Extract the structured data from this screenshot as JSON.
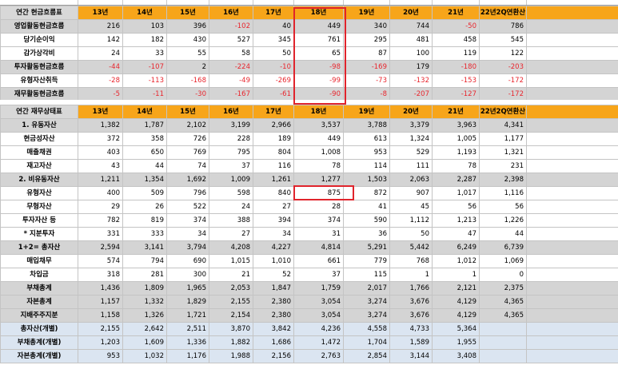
{
  "colors": {
    "header_orange": "#f7a51a",
    "negative_red": "#e8262e",
    "highlight_gray": "#d4d4d4",
    "standalone_blue": "#dbe5f1",
    "annotation_box_red": "#e0242c"
  },
  "cashflow": {
    "headers": [
      "연간 현금흐름표",
      "13년",
      "14년",
      "15년",
      "16년",
      "17년",
      "18년",
      "19년",
      "20년",
      "21년",
      "22년2Q연환산"
    ],
    "rows": [
      {
        "label": "영업활동현금흐름",
        "values": [
          "216",
          "103",
          "396",
          "-102",
          "40",
          "449",
          "340",
          "744",
          "-50",
          "786"
        ]
      },
      {
        "label": "당기순이익",
        "values": [
          "142",
          "182",
          "430",
          "527",
          "345",
          "761",
          "295",
          "481",
          "458",
          "545"
        ]
      },
      {
        "label": "감가상각비",
        "values": [
          "24",
          "33",
          "55",
          "58",
          "50",
          "65",
          "87",
          "100",
          "119",
          "122"
        ]
      },
      {
        "label": "투자활동현금흐름",
        "values": [
          "-44",
          "-107",
          "2",
          "-224",
          "-10",
          "-98",
          "-169",
          "179",
          "-180",
          "-203"
        ]
      },
      {
        "label": "유형자산취득",
        "values": [
          "-28",
          "-113",
          "-168",
          "-49",
          "-269",
          "-99",
          "-73",
          "-132",
          "-153",
          "-172"
        ]
      },
      {
        "label": "재무활동현금흐름",
        "values": [
          "-5",
          "-11",
          "-30",
          "-167",
          "-61",
          "-90",
          "-8",
          "-207",
          "-127",
          "-172"
        ]
      }
    ]
  },
  "balance": {
    "headers": [
      "연간 재무상태표",
      "13년",
      "14년",
      "15년",
      "16년",
      "17년",
      "18년",
      "19년",
      "20년",
      "21년",
      "22년2Q연환산"
    ],
    "rows": [
      {
        "label": "1. 유동자산",
        "values": [
          "1,382",
          "1,787",
          "2,102",
          "3,199",
          "2,966",
          "3,537",
          "3,788",
          "3,379",
          "3,963",
          "4,341"
        ]
      },
      {
        "label": "현금성자산",
        "values": [
          "372",
          "358",
          "726",
          "228",
          "189",
          "449",
          "613",
          "1,324",
          "1,005",
          "1,177"
        ]
      },
      {
        "label": "매출채권",
        "values": [
          "403",
          "650",
          "769",
          "795",
          "804",
          "1,008",
          "953",
          "529",
          "1,193",
          "1,321"
        ]
      },
      {
        "label": "재고자산",
        "values": [
          "43",
          "44",
          "74",
          "37",
          "116",
          "78",
          "114",
          "111",
          "78",
          "231"
        ]
      },
      {
        "label": "2. 비유동자산",
        "values": [
          "1,211",
          "1,354",
          "1,692",
          "1,009",
          "1,261",
          "1,277",
          "1,503",
          "2,063",
          "2,287",
          "2,398"
        ]
      },
      {
        "label": "유형자산",
        "values": [
          "400",
          "509",
          "796",
          "598",
          "840",
          "875",
          "872",
          "907",
          "1,017",
          "1,116"
        ]
      },
      {
        "label": "무형자산",
        "values": [
          "29",
          "26",
          "522",
          "24",
          "27",
          "28",
          "41",
          "45",
          "56",
          "56"
        ]
      },
      {
        "label": "투자자산 등",
        "values": [
          "782",
          "819",
          "374",
          "388",
          "394",
          "374",
          "590",
          "1,112",
          "1,213",
          "1,226"
        ]
      },
      {
        "label": "* 지분투자",
        "values": [
          "331",
          "333",
          "34",
          "27",
          "34",
          "31",
          "36",
          "50",
          "47",
          "44"
        ]
      },
      {
        "label": "1+2= 총자산",
        "values": [
          "2,594",
          "3,141",
          "3,794",
          "4,208",
          "4,227",
          "4,814",
          "5,291",
          "5,442",
          "6,249",
          "6,739"
        ]
      },
      {
        "label": "매입채무",
        "values": [
          "574",
          "794",
          "690",
          "1,015",
          "1,010",
          "661",
          "779",
          "768",
          "1,012",
          "1,069"
        ]
      },
      {
        "label": "차입금",
        "values": [
          "318",
          "281",
          "300",
          "21",
          "52",
          "37",
          "115",
          "1",
          "1",
          "0"
        ]
      },
      {
        "label": "부채총계",
        "values": [
          "1,436",
          "1,809",
          "1,965",
          "2,053",
          "1,847",
          "1,759",
          "2,017",
          "1,766",
          "2,121",
          "2,375"
        ]
      },
      {
        "label": "자본총계",
        "values": [
          "1,157",
          "1,332",
          "1,829",
          "2,155",
          "2,380",
          "3,054",
          "3,274",
          "3,676",
          "4,129",
          "4,365"
        ]
      },
      {
        "label": "지배주주지분",
        "values": [
          "1,158",
          "1,326",
          "1,721",
          "2,154",
          "2,380",
          "3,054",
          "3,274",
          "3,676",
          "4,129",
          "4,365"
        ]
      },
      {
        "label": "총자산(개별)",
        "values": [
          "2,155",
          "2,642",
          "2,511",
          "3,870",
          "3,842",
          "4,236",
          "4,558",
          "4,733",
          "5,364",
          ""
        ]
      },
      {
        "label": "부채총계(개별)",
        "values": [
          "1,203",
          "1,609",
          "1,336",
          "1,882",
          "1,686",
          "1,472",
          "1,704",
          "1,589",
          "1,955",
          ""
        ]
      },
      {
        "label": "자본총계(개별)",
        "values": [
          "953",
          "1,032",
          "1,176",
          "1,988",
          "2,156",
          "2,763",
          "2,854",
          "3,144",
          "3,408",
          ""
        ]
      }
    ]
  }
}
